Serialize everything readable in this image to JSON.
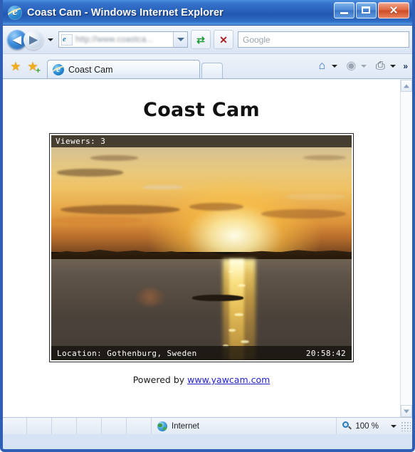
{
  "window": {
    "title": "Coast Cam - Windows Internet Explorer",
    "ie_icon": "internet-explorer-icon",
    "minimize_label": "Minimize",
    "maximize_label": "Maximize",
    "close_label": "Close",
    "close_glyph": "✕"
  },
  "navigation": {
    "back_glyph": "◀",
    "forward_glyph": "▶",
    "back_label": "Back",
    "forward_label": "Forward",
    "recent_pages_label": "Recent Pages"
  },
  "address_bar": {
    "url": "http://www.coastca...",
    "favicon": "page-icon",
    "dropdown_label": "Address history"
  },
  "toolbar_buttons": {
    "refresh_glyph": "⇄",
    "refresh_label": "Refresh",
    "stop_glyph": "✕",
    "stop_label": "Stop"
  },
  "search": {
    "placeholder": "Google",
    "value": ""
  },
  "favorites": {
    "favorites_glyph": "★",
    "favorites_label": "Favorites Center",
    "add_glyph": "★",
    "add_label": "Add to Favorites"
  },
  "tabs": [
    {
      "label": "Coast Cam",
      "active": true,
      "icon": "internet-explorer-icon"
    }
  ],
  "new_tab": {
    "label": "New Tab"
  },
  "command_bar": {
    "home_glyph": "⌂",
    "home_label": "Home",
    "feeds_glyph": "◉",
    "feeds_label": "Feeds",
    "print_glyph": "⎙",
    "print_label": "Print",
    "overflow_glyph": "»",
    "overflow_label": "More commands"
  },
  "page": {
    "heading": "Coast Cam",
    "webcam": {
      "viewers_text": "Viewers: 3",
      "location_text": "Location: Gothenburg, Sweden",
      "time_text": "20:58:42",
      "alt": "Sunset over the sea at Gothenburg"
    },
    "footer_prefix": "Powered by ",
    "footer_link": "www.yawcam.com"
  },
  "scrollbar": {
    "up_label": "Scroll up",
    "down_label": "Scroll down"
  },
  "statusbar": {
    "zone": "Internet",
    "zone_icon": "globe-icon",
    "zoom_level": "100 %",
    "zoom_icon": "magnifier-icon",
    "zoom_dropdown_label": "Change zoom level"
  },
  "colors": {
    "title_blue": "#2358b0",
    "frame_blue": "#2e5fb5",
    "link_blue": "#2222cc",
    "close_red": "#cf4d26",
    "sun_gold": "#ffd660"
  }
}
